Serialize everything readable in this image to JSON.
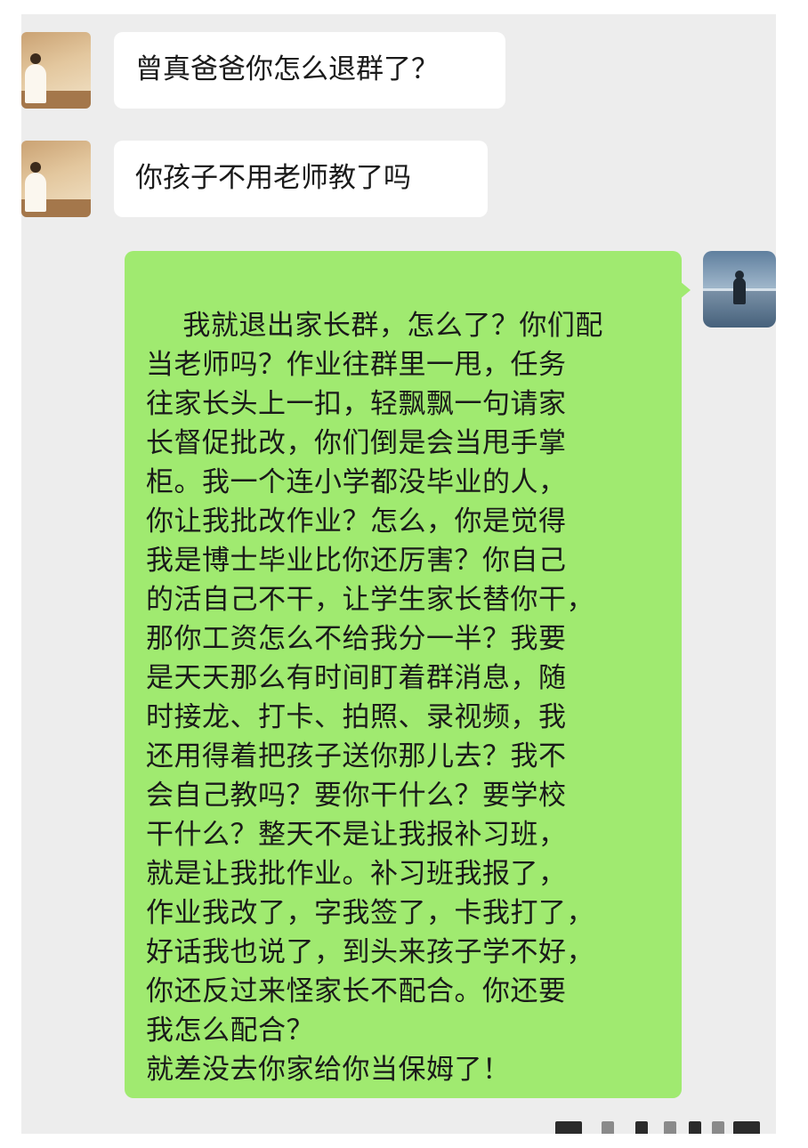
{
  "messages": [
    {
      "sender": "other",
      "text": "曾真爸爸你怎么退群了？"
    },
    {
      "sender": "other",
      "text": "你孩子不用老师教了吗"
    },
    {
      "sender": "self",
      "text": "我就退出家长群，怎么了？你们配\n当老师吗？作业往群里一甩，任务\n往家长头上一扣，轻飘飘一句请家\n长督促批改，你们倒是会当甩手掌\n柜。我一个连小学都没毕业的人，\n你让我批改作业？怎么，你是觉得\n我是博士毕业比你还厉害？你自己\n的活自己不干，让学生家长替你干，\n那你工资怎么不给我分一半？我要\n是天天那么有时间盯着群消息，随\n时接龙、打卡、拍照、录视频，我\n还用得着把孩子送你那儿去？我不\n会自己教吗？要你干什么？要学校\n干什么？整天不是让我报补习班，\n就是让我批作业。补习班我报了，\n作业我改了，字我签了，卡我打了，\n好话我也说了，到头来孩子学不好，\n你还反过来怪家长不配合。你还要\n我怎么配合？\n就差没去你家给你当保姆了！"
    }
  ],
  "colors": {
    "chat_background": "#ededed",
    "incoming_bubble": "#ffffff",
    "outgoing_bubble": "#a0ea70",
    "text": "#1a1a1a"
  },
  "icons": {
    "other_avatar": "avatar-woman-painting-icon",
    "self_avatar": "avatar-person-by-sea-icon"
  }
}
